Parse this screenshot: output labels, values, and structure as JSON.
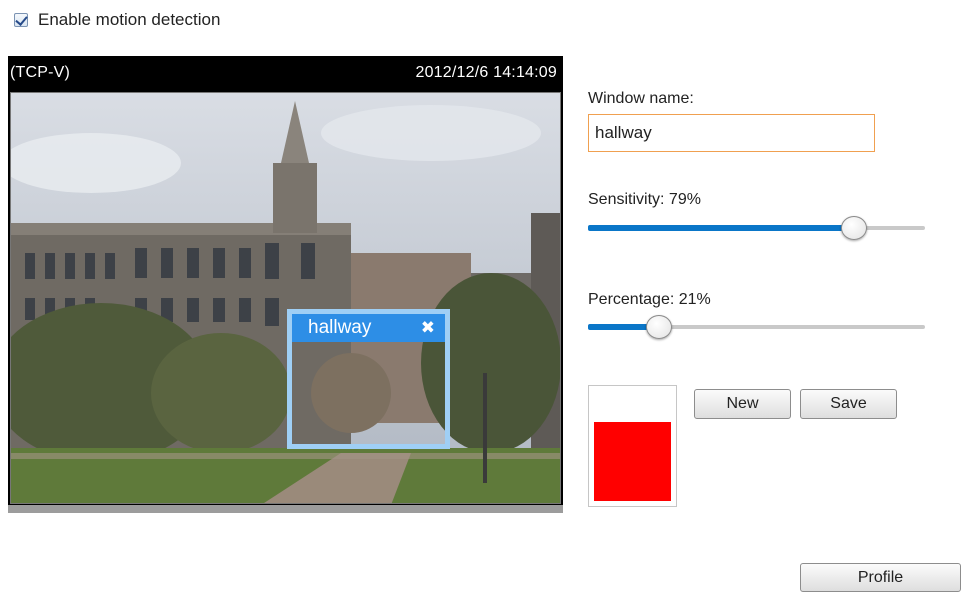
{
  "motion": {
    "enable_label": "Enable motion detection",
    "enabled": true
  },
  "video": {
    "stream_label": "(TCP-V)",
    "timestamp": "2012/12/6 14:14:09"
  },
  "window": {
    "overlay_name": "hallway",
    "close_icon": "close-x-icon",
    "name_label": "Window name:",
    "name_value": "hallway"
  },
  "sensitivity": {
    "label": "Sensitivity: 79%",
    "value_percent": 79
  },
  "percentage": {
    "label": "Percentage: 21%",
    "value_percent": 21
  },
  "indicator": {
    "level_percent": 66,
    "color": "#ff0000"
  },
  "buttons": {
    "new_label": "New",
    "save_label": "Save",
    "profile_label": "Profile"
  },
  "colors": {
    "accent": "#0a76c8",
    "overlay_header": "#2d8ee6",
    "overlay_border": "#9fcff5",
    "input_border": "#f0a050"
  }
}
